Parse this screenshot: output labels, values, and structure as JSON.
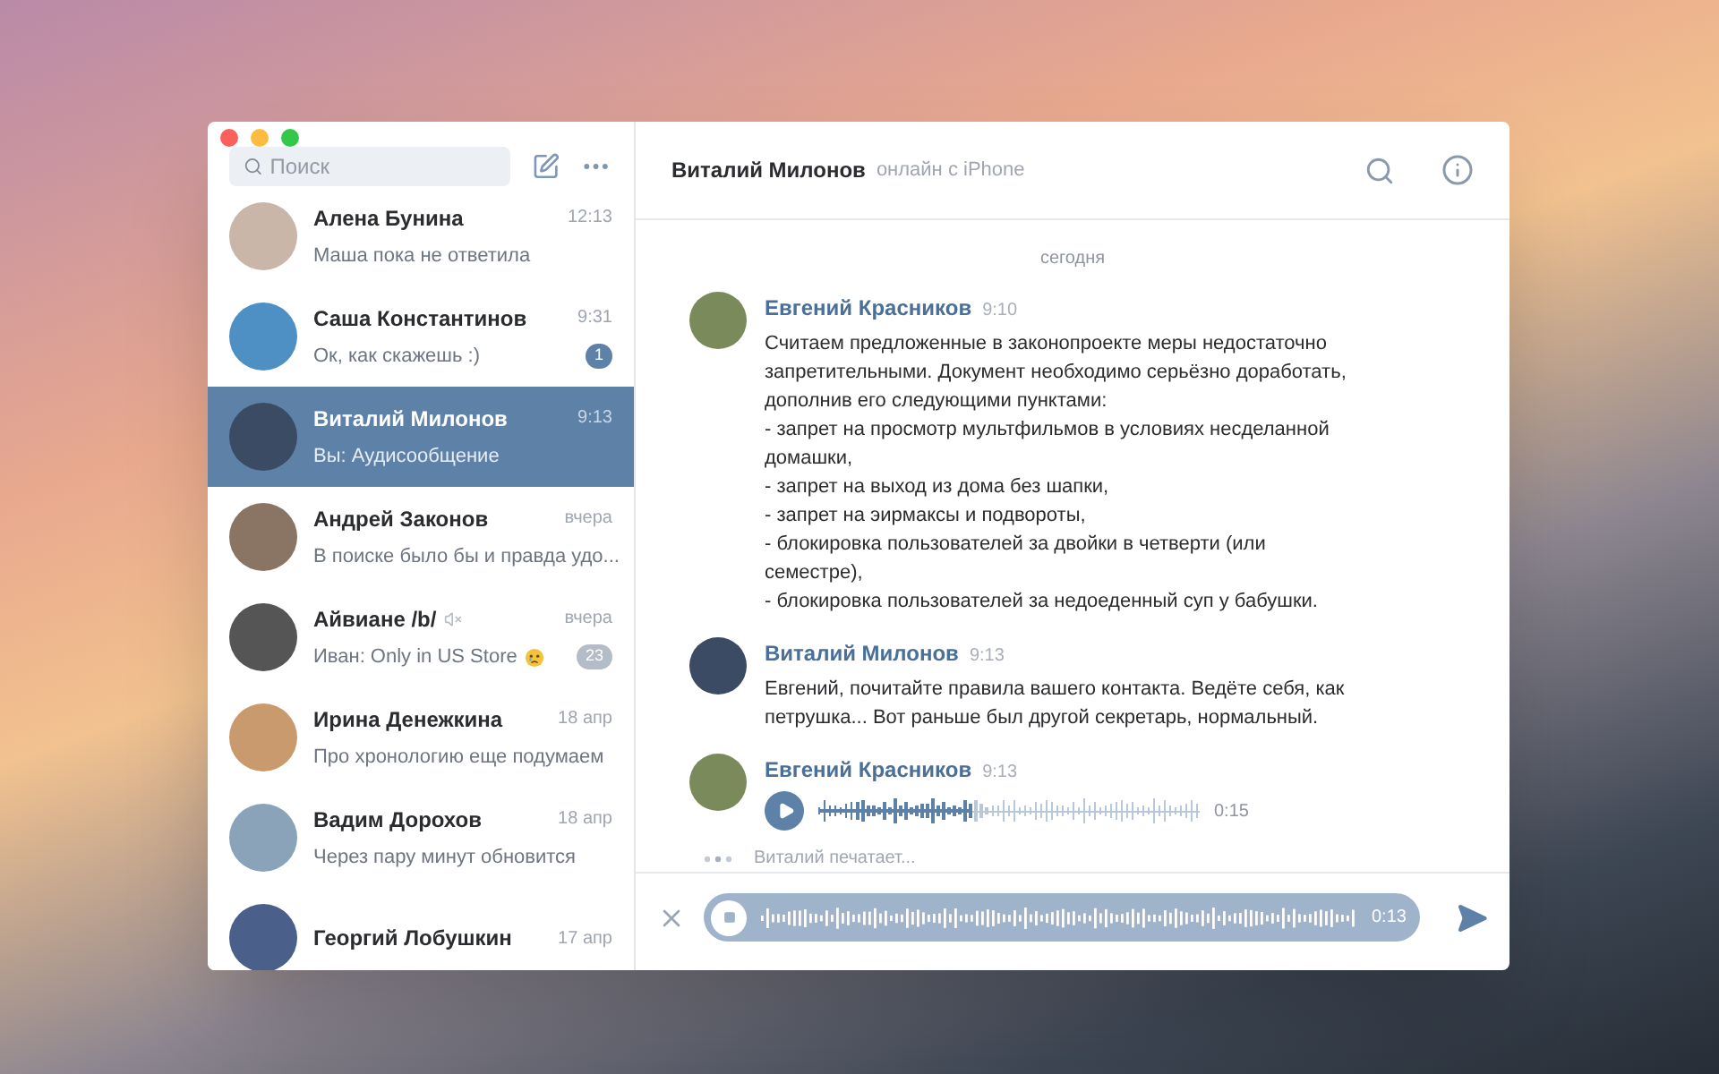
{
  "sidebar": {
    "search": {
      "placeholder": "Поиск"
    },
    "dialogs": [
      {
        "name": "Алена Бунина",
        "time": "12:13",
        "preview": "Маша пока не ответила",
        "selected": false,
        "muted": false,
        "color": "#c9b6a8"
      },
      {
        "name": "Саша Константинов",
        "time": "9:31",
        "preview": "Ок, как скажешь :)",
        "unread": "1",
        "selected": false,
        "muted": false,
        "color": "#4e8fc4"
      },
      {
        "name": "Виталий Милонов",
        "time": "9:13",
        "preview": "Вы: Аудисообщение",
        "selected": true,
        "muted": false,
        "color": "#3a4b63"
      },
      {
        "name": "Андрей Законов",
        "time": "вчера",
        "preview": "В поиске было бы и правда удо...",
        "selected": false,
        "muted": false,
        "color": "#8a7565"
      },
      {
        "name": "Айвиане /b/",
        "time": "вчера",
        "preview": "Иван: Only in US Store",
        "emoji": true,
        "unread": "23",
        "selected": false,
        "muted": true,
        "color": "#555555"
      },
      {
        "name": "Ирина Денежкина",
        "time": "18 апр",
        "preview": "Про хронологию еще подумаем",
        "selected": false,
        "muted": false,
        "color": "#c99a6e"
      },
      {
        "name": "Вадим Дорохов",
        "time": "18 апр",
        "preview": "Через пару минут обновится",
        "selected": false,
        "muted": false,
        "color": "#8aa3b8"
      },
      {
        "name": "Георгий Лобушкин",
        "time": "17 апр",
        "selected": false,
        "muted": false,
        "color": "#4a5f8a"
      }
    ]
  },
  "chat": {
    "name": "Виталий Милонов",
    "status": "онлайн с iPhone",
    "date": "сегодня",
    "messages": [
      {
        "kind": "text",
        "author": "Евгений Красников",
        "time": "9:10",
        "color": "#7a8a5a",
        "text": "Считаем предложенные в законопроекте меры недостаточно\nзапретительными. Документ необходимо серьёзно доработать,\nдополнив его следующими пунктами:\n- запрет на просмотр мультфильмов в условиях несделанной\nдомашки,\n- запрет на выход из дома без шапки,\n- запрет на эирмаксы и подвороты,\n- блокировка пользователей за двойки в четверти (или\nсеместре),\n- блокировка пользователей за недоеденный суп у бабушки."
      },
      {
        "kind": "text",
        "author": "Виталий Милонов",
        "time": "9:13",
        "color": "#3a4b63",
        "text": "Евгений, почитайте правила вашего контакта. Ведёте себя, как\nпетрушка... Вот раньше был другой секретарь, нормальный."
      },
      {
        "kind": "voice",
        "author": "Евгений Красников",
        "time": "9:13",
        "color": "#7a8a5a",
        "level": 0.4,
        "duration": "0:15"
      }
    ],
    "typing": "Виталий печатает...",
    "recording": {
      "duration": "0:13"
    }
  }
}
